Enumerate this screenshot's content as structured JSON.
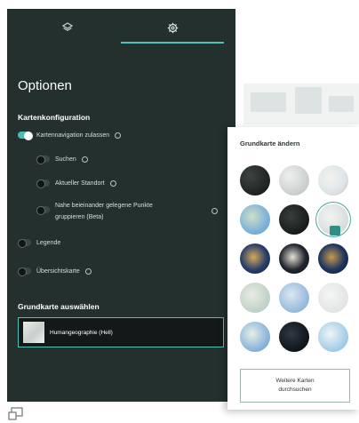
{
  "tabs": [
    {
      "name": "layers",
      "icon": "layers-icon"
    },
    {
      "name": "settings",
      "icon": "gear-icon",
      "active": true
    }
  ],
  "options": {
    "title": "Optionen",
    "map_config": {
      "heading": "Kartenkonfiguration",
      "map_navigation": {
        "label": "Kartennavigation zulassen",
        "enabled": true
      },
      "search": {
        "label": "Suchen",
        "enabled": false
      },
      "current_location": {
        "label": "Aktueller Standort",
        "enabled": false
      },
      "group_points": {
        "label_line1": "Nahe beieinander gelegene Punkte",
        "label_line2": "gruppieren (Beta)",
        "enabled": false
      },
      "legend": {
        "label": "Legende",
        "enabled": false
      },
      "overview_map": {
        "label": "Übersichtskarte",
        "enabled": false
      }
    },
    "basemap": {
      "heading": "Grundkarte auswählen",
      "selected": "Humangeographie (Hell)"
    }
  },
  "basemap_popup": {
    "title": "Grundkarte ändern",
    "more_button_line1": "Weitere Karten",
    "more_button_line2": "durchsuchen",
    "selected_index": 5
  },
  "colors": {
    "panel": "#23302e",
    "accent": "#50c3b8"
  }
}
